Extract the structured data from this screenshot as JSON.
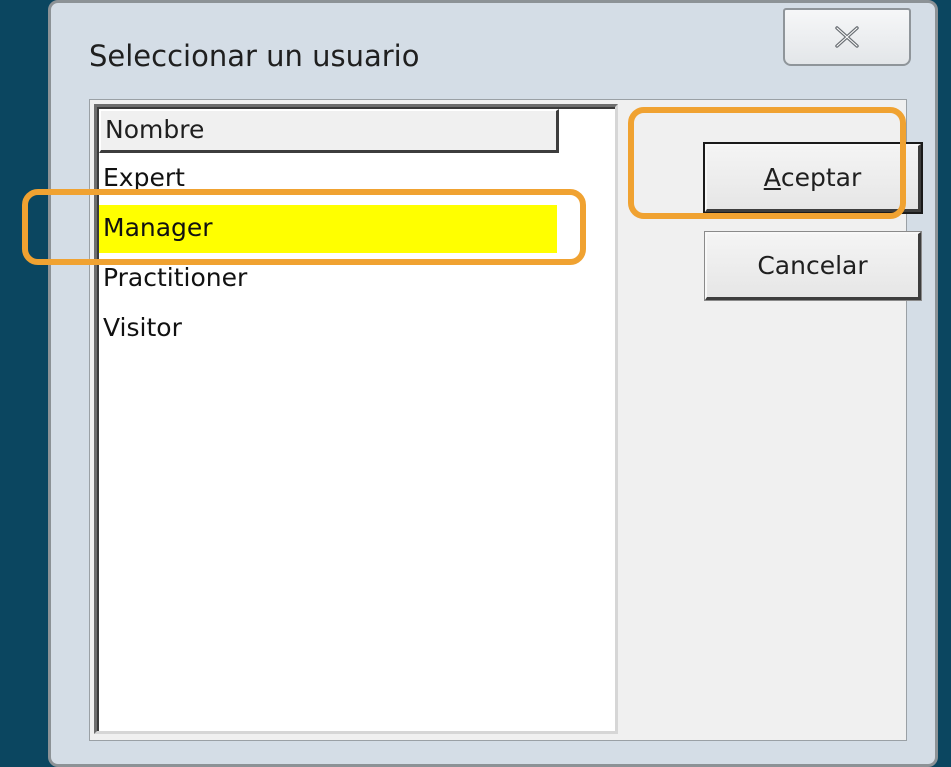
{
  "dialog": {
    "title": "Seleccionar un usuario",
    "close_icon": "close-x-icon"
  },
  "list": {
    "column_header": "Nombre",
    "items": [
      "Expert",
      "Manager",
      "Practitioner",
      "Visitor"
    ],
    "selected": "Manager",
    "selected_color": "#ffff00"
  },
  "buttons": {
    "ok_accel": "A",
    "ok_rest": "ceptar",
    "cancel": "Cancelar"
  },
  "colors": {
    "annotation_outline": "#f0a231",
    "background": "#0b4660"
  }
}
